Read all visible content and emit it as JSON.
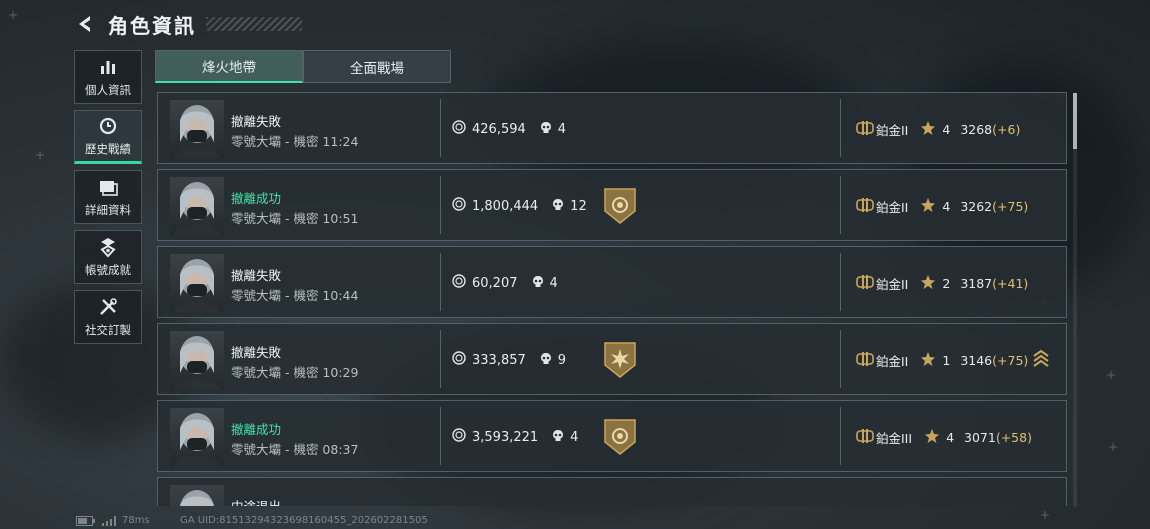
{
  "header": {
    "title": "角色資訊"
  },
  "sidebar": {
    "items": [
      {
        "label": "個人資訊",
        "icon": "bar-chart-icon"
      },
      {
        "label": "歷史戰績",
        "icon": "clock-icon"
      },
      {
        "label": "詳細資料",
        "icon": "document-icon"
      },
      {
        "label": "帳號成就",
        "icon": "medal-icon"
      },
      {
        "label": "社交訂製",
        "icon": "tools-icon"
      }
    ]
  },
  "tabs": [
    {
      "label": "烽火地帶"
    },
    {
      "label": "全面戰場"
    }
  ],
  "matches": [
    {
      "status": "撤離失敗",
      "success": false,
      "map": "零號大壩 - 機密 11:24",
      "money": "426,594",
      "kills": "4",
      "badge": "",
      "rank": "鉑金II",
      "stars": "4",
      "score": "3268",
      "delta": "(+6)",
      "promo": false
    },
    {
      "status": "撤離成功",
      "success": true,
      "map": "零號大壩 - 機密 10:51",
      "money": "1,800,444",
      "kills": "12",
      "badge": "target",
      "rank": "鉑金II",
      "stars": "4",
      "score": "3262",
      "delta": "(+75)",
      "promo": false
    },
    {
      "status": "撤離失敗",
      "success": false,
      "map": "零號大壩 - 機密 10:44",
      "money": "60,207",
      "kills": "4",
      "badge": "",
      "rank": "鉑金II",
      "stars": "2",
      "score": "3187",
      "delta": "(+41)",
      "promo": false
    },
    {
      "status": "撤離失敗",
      "success": false,
      "map": "零號大壩 - 機密 10:29",
      "money": "333,857",
      "kills": "9",
      "badge": "burst",
      "rank": "鉑金II",
      "stars": "1",
      "score": "3146",
      "delta": "(+75)",
      "promo": true
    },
    {
      "status": "撤離成功",
      "success": true,
      "map": "零號大壩 - 機密 08:37",
      "money": "3,593,221",
      "kills": "4",
      "badge": "target",
      "rank": "鉑金III",
      "stars": "4",
      "score": "3071",
      "delta": "(+58)",
      "promo": false
    },
    {
      "status": "中途退出",
      "success": false,
      "map": "",
      "money": "",
      "kills": "",
      "badge": "",
      "rank": "",
      "stars": "",
      "score": "",
      "delta": "",
      "promo": false
    }
  ],
  "footer": {
    "ping": "78ms",
    "uid": "GA UID:81513294323698160455_202602281505"
  },
  "colors": {
    "accent": "#41e0ad",
    "success": "#3fe3a6",
    "delta": "#e0c06b",
    "gold": "#c9a55a"
  }
}
